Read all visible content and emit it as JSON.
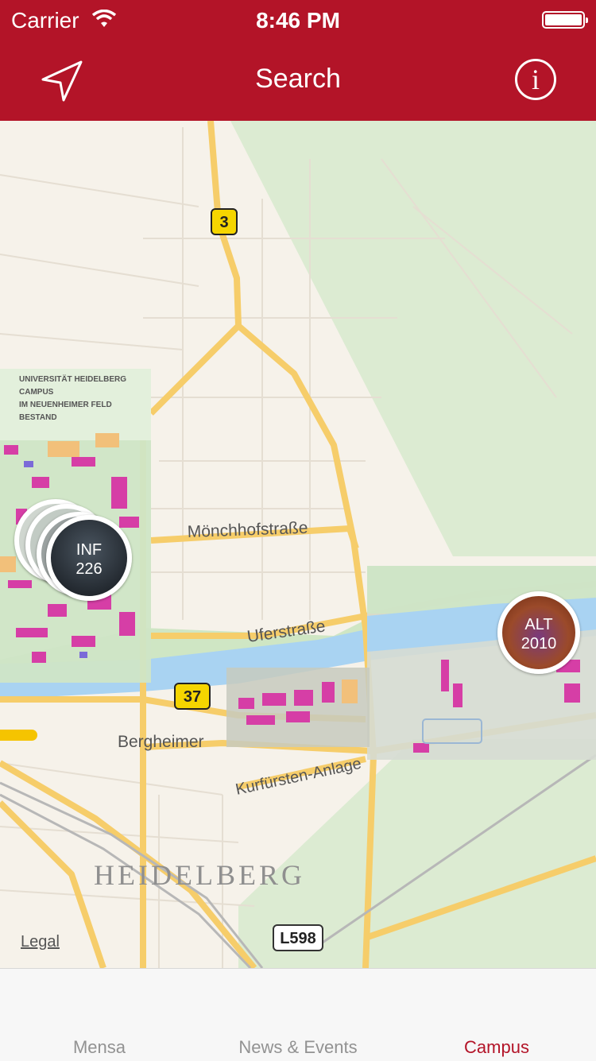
{
  "status_bar": {
    "carrier": "Carrier",
    "time": "8:46 PM"
  },
  "nav": {
    "title": "Search",
    "info_glyph": "i",
    "left_icon": "location-arrow-icon",
    "right_icon": "info-icon"
  },
  "colors": {
    "brand": "#b31428",
    "tab_inactive": "#929292"
  },
  "map": {
    "labels": {
      "street_1": "Mönchhofstraße",
      "street_2": "Uferstraße",
      "street_3": "Kurfürsten-Anlage",
      "district": "Bergheimer",
      "city": "HEIDELBERG",
      "route_3": "3",
      "route_37": "37",
      "route_l598": "L598",
      "overlay_title": "UNIVERSITÄT HEIDELBERG",
      "overlay_campus": "CAMPUS",
      "overlay_field": "IM NEUENHEIMER FELD",
      "overlay_status": "BESTAND"
    },
    "pins": [
      {
        "line1": "INF",
        "line2": "226"
      },
      {
        "line1": "ALT",
        "line2": "2010"
      }
    ],
    "legal": "Legal"
  },
  "tabs": [
    {
      "label": "Mensa",
      "active": false
    },
    {
      "label": "News & Events",
      "active": false
    },
    {
      "label": "Campus",
      "active": true
    }
  ]
}
